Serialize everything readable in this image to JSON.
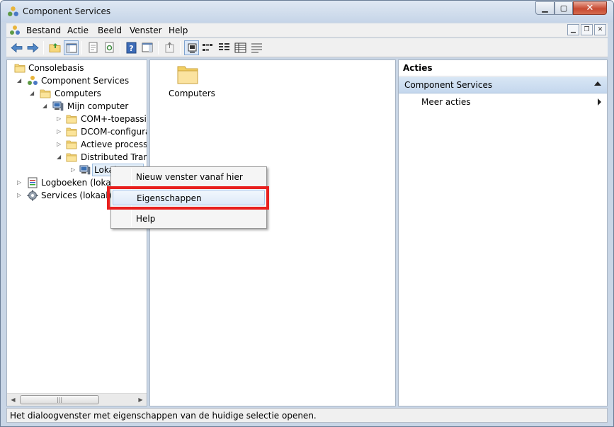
{
  "window": {
    "title": "Component Services"
  },
  "menu": {
    "items": [
      "Bestand",
      "Actie",
      "Beeld",
      "Venster",
      "Help"
    ]
  },
  "tree": {
    "items": [
      {
        "label": "Consolebasis",
        "icon": "folder-icon"
      },
      {
        "label": "Component Services",
        "icon": "component-services-icon"
      },
      {
        "label": "Computers",
        "icon": "folder-icon"
      },
      {
        "label": "Mijn computer",
        "icon": "computer-icon"
      },
      {
        "label": "COM+-toepassin",
        "icon": "folder-icon"
      },
      {
        "label": "DCOM-configura",
        "icon": "folder-icon"
      },
      {
        "label": "Actieve processer",
        "icon": "folder-icon"
      },
      {
        "label": "Distributed Transa",
        "icon": "folder-icon"
      },
      {
        "label": "Lokale DTC",
        "icon": "computer-icon"
      },
      {
        "label": "Logboeken (lokaal)",
        "icon": "event-log-icon"
      },
      {
        "label": "Services (lokaal)",
        "icon": "gear-icon"
      }
    ]
  },
  "content": {
    "items": [
      {
        "label": "Computers",
        "icon": "folder-icon"
      }
    ]
  },
  "actions": {
    "title": "Acties",
    "group": "Component Services",
    "more": "Meer acties"
  },
  "context_menu": {
    "items": [
      "Nieuw venster vanaf hier",
      "Eigenschappen",
      "Help"
    ],
    "highlighted": "Eigenschappen",
    "highlight_color": "#e8201e"
  },
  "statusbar": {
    "text": "Het dialoogvenster met eigenschappen van de huidige selectie openen."
  },
  "colors": {
    "folder": "#f6d77c",
    "selection": "#e3eef9",
    "titlebar": "#c6d5e8"
  }
}
